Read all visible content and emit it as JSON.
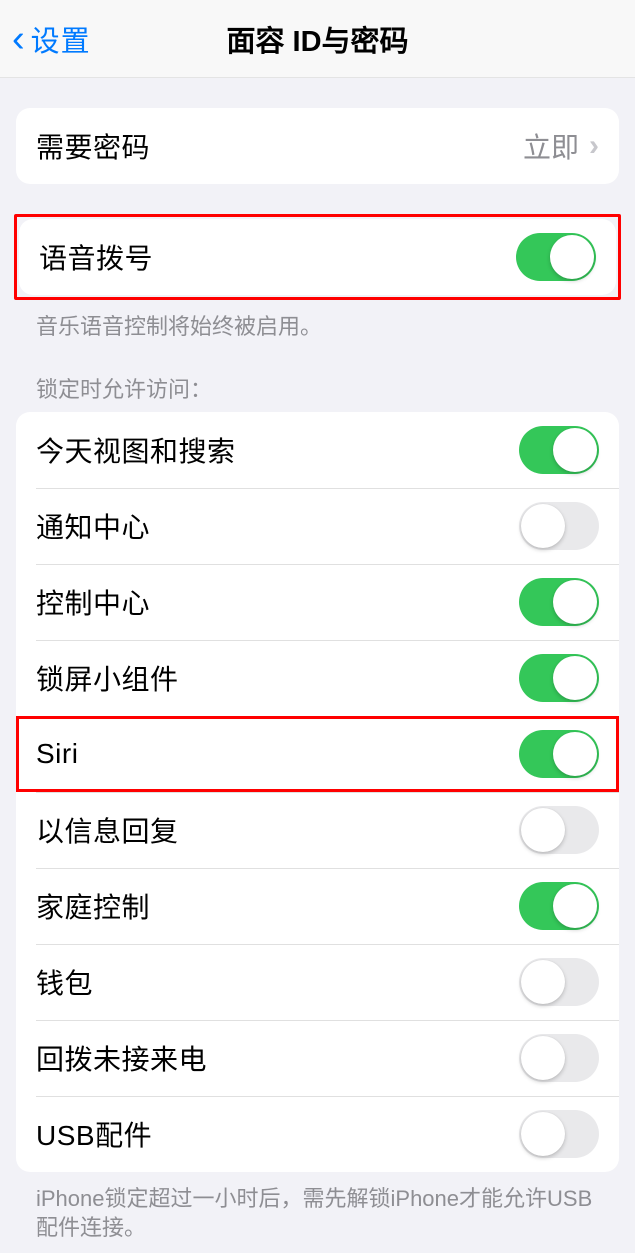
{
  "nav": {
    "back_label": "设置",
    "title": "面容 ID与密码"
  },
  "require_passcode": {
    "label": "需要密码",
    "value": "立即"
  },
  "voice_dial": {
    "label": "语音拨号",
    "footer": "音乐语音控制将始终被启用。"
  },
  "lock_access": {
    "header": "锁定时允许访问：",
    "items": [
      {
        "label": "今天视图和搜索",
        "on": true
      },
      {
        "label": "通知中心",
        "on": false
      },
      {
        "label": "控制中心",
        "on": true
      },
      {
        "label": "锁屏小组件",
        "on": true
      },
      {
        "label": "Siri",
        "on": true
      },
      {
        "label": "以信息回复",
        "on": false
      },
      {
        "label": "家庭控制",
        "on": true
      },
      {
        "label": "钱包",
        "on": false
      },
      {
        "label": "回拨未接来电",
        "on": false
      },
      {
        "label": "USB配件",
        "on": false
      }
    ],
    "footer": "iPhone锁定超过一小时后，需先解锁iPhone才能允许USB 配件连接。"
  }
}
